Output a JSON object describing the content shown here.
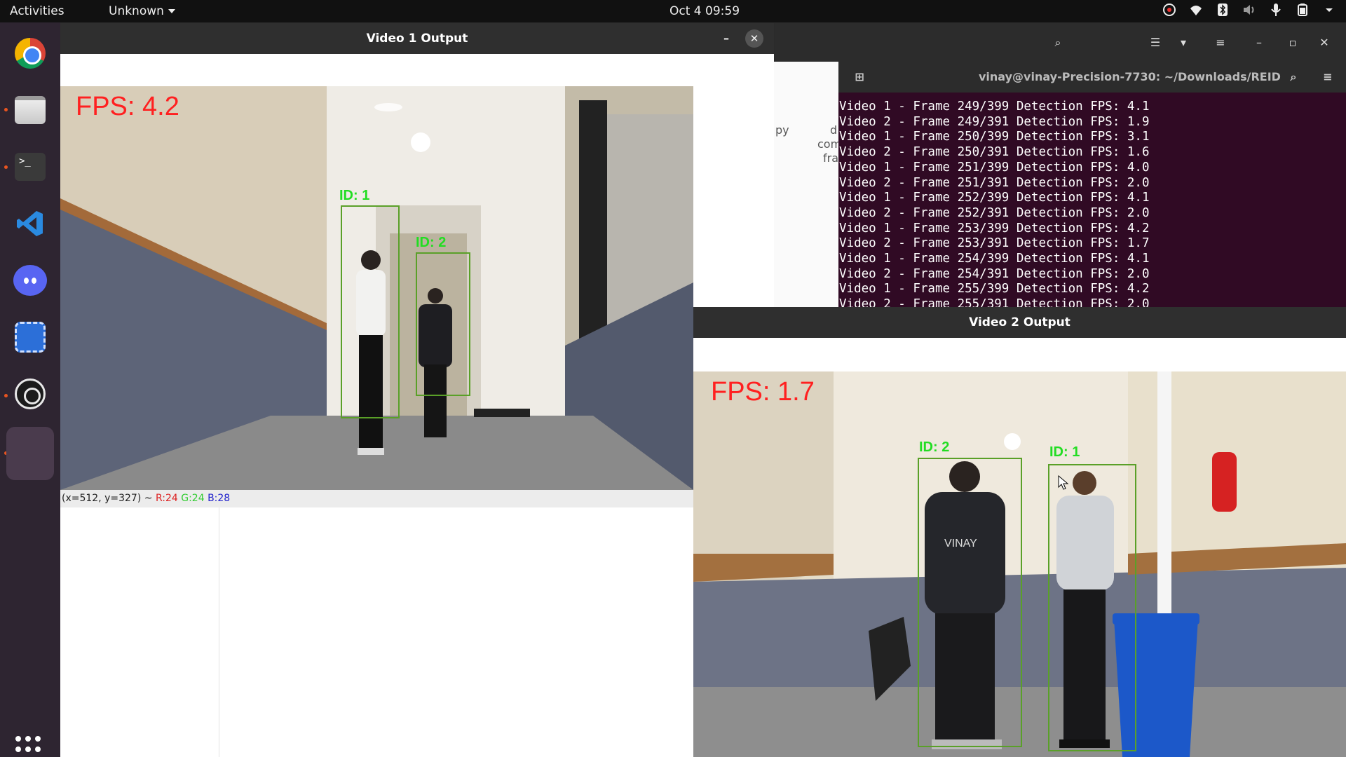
{
  "topbar": {
    "activities": "Activities",
    "app_menu": "Unknown",
    "clock": "Oct 4  09:59",
    "tray_icons": [
      "ubuntu-updates-icon",
      "wifi-icon",
      "bluetooth-icon",
      "volume-icon",
      "microphone-icon",
      "battery-icon",
      "chevron-down-icon"
    ]
  },
  "dock": {
    "apps": [
      "Google Chrome",
      "Files",
      "Terminal",
      "Visual Studio Code",
      "Discord",
      "Screenshot",
      "OBS Studio",
      "Active app"
    ],
    "show_apps_icon": "grid-icon"
  },
  "background_window": {
    "file_labels": [
      "py",
      "d",
      "com",
      "fra"
    ]
  },
  "terminal": {
    "title": "vinay@vinay-Precision-7730: ~/Downloads/REID",
    "lines": [
      "Video 1 - Frame 249/399 Detection FPS: 4.1",
      "Video 2 - Frame 249/391 Detection FPS: 1.9",
      "Video 1 - Frame 250/399 Detection FPS: 3.1",
      "Video 2 - Frame 250/391 Detection FPS: 1.6",
      "Video 1 - Frame 251/399 Detection FPS: 4.0",
      "Video 2 - Frame 251/391 Detection FPS: 2.0",
      "Video 1 - Frame 252/399 Detection FPS: 4.1",
      "Video 2 - Frame 252/391 Detection FPS: 2.0",
      "Video 1 - Frame 253/399 Detection FPS: 4.2",
      "Video 2 - Frame 253/391 Detection FPS: 1.7",
      "Video 1 - Frame 254/399 Detection FPS: 4.1",
      "Video 2 - Frame 254/391 Detection FPS: 2.0",
      "Video 1 - Frame 255/399 Detection FPS: 4.2",
      "Video 2 - Frame 255/391 Detection FPS: 2.0"
    ]
  },
  "video1": {
    "title": "Video 1 Output",
    "fps": "FPS: 4.2",
    "status": {
      "coords": "(x=512, y=327) ~ ",
      "r": "R:24",
      "g": "G:24",
      "b": "B:28"
    },
    "boxes": [
      {
        "label": "ID: 1"
      },
      {
        "label": "ID: 2"
      }
    ]
  },
  "video2": {
    "title": "Video 2 Output",
    "fps": "FPS: 1.7",
    "boxes": [
      {
        "label": "ID: 2"
      },
      {
        "label": "ID: 1"
      }
    ]
  },
  "colors": {
    "terminal_bg": "#300a24",
    "fps_text": "#ff2020",
    "bbox": "#5aa028",
    "bbox_label": "#22dd22",
    "dock_bg": "#2e2531"
  }
}
